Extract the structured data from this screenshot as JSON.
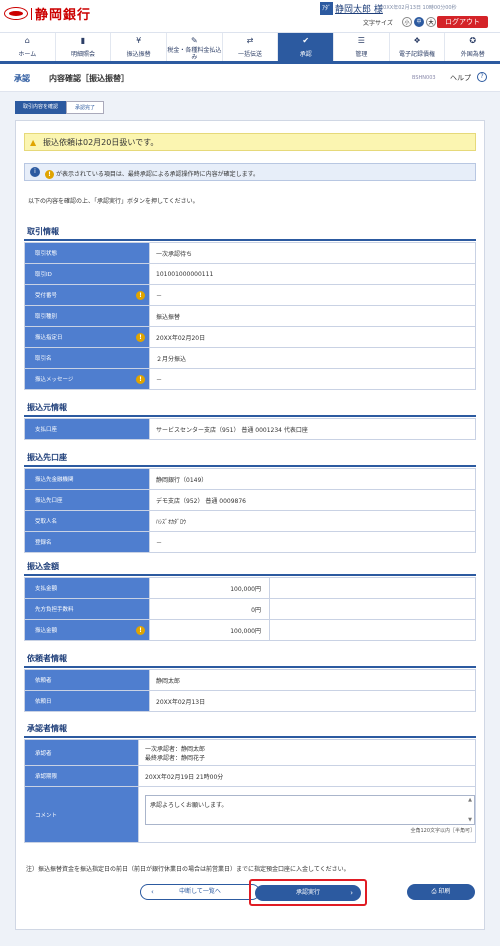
{
  "header": {
    "logo_text": "静岡銀行",
    "user_icon": "ｱﾀﾞ",
    "user_name": "静岡太郎 様",
    "datetime": "20XX年02月13日 10時00分00秒",
    "font_size_label": "文字サイズ",
    "font_sizes": [
      "小",
      "中",
      "大"
    ],
    "logout": "ログアウト"
  },
  "nav": [
    {
      "label": "ホーム",
      "icon": "home-icon",
      "glyph": "⌂"
    },
    {
      "label": "明細照会",
      "icon": "document-icon",
      "glyph": "▮"
    },
    {
      "label": "振込振替",
      "icon": "transfer-icon",
      "glyph": "¥"
    },
    {
      "label": "税金・各種料金払込み",
      "icon": "tax-icon",
      "glyph": "✎"
    },
    {
      "label": "一括伝送",
      "icon": "batch-icon",
      "glyph": "⇄"
    },
    {
      "label": "承認",
      "icon": "approve-icon",
      "glyph": "✔"
    },
    {
      "label": "管理",
      "icon": "admin-icon",
      "glyph": "☰"
    },
    {
      "label": "電子記録債権",
      "icon": "ecredit-icon",
      "glyph": "❖"
    },
    {
      "label": "外国為替",
      "icon": "forex-icon",
      "glyph": "✪"
    }
  ],
  "title": {
    "main": "承認",
    "sub": "内容確認［振込振替］",
    "code": "BSHN003",
    "help": "ヘルプ"
  },
  "steps": [
    "取引内容を確認",
    "承認完了"
  ],
  "notice": "振込依頼は02月20日扱いです。",
  "info": "が表示されている項目は、最終承認による承認操作時に内容が確定します。",
  "instruction": "以下の内容を確認の上、「承認実行」ボタンを押してください。",
  "sections": {
    "torihiki": {
      "title": "取引情報",
      "rows": [
        {
          "label": "取引状態",
          "value": "一次承認待ち",
          "warn": false
        },
        {
          "label": "取引ID",
          "value": "101001000000111",
          "warn": false
        },
        {
          "label": "受付番号",
          "value": "－",
          "warn": true
        },
        {
          "label": "取引種別",
          "value": "振込振替",
          "warn": false
        },
        {
          "label": "振込指定日",
          "value": "20XX年02月20日",
          "warn": true
        },
        {
          "label": "取引名",
          "value": "２月分振込",
          "warn": false
        },
        {
          "label": "振込メッセージ",
          "value": "－",
          "warn": true
        }
      ]
    },
    "moto": {
      "title": "振込元情報",
      "rows": [
        {
          "label": "支払口座",
          "value": "サービスセンター支店（951） 普通 0001234 代表口座",
          "warn": false
        }
      ]
    },
    "saki": {
      "title": "振込先口座",
      "rows": [
        {
          "label": "振込先金融機関",
          "value": "静岡銀行（0149）",
          "warn": false
        },
        {
          "label": "振込先口座",
          "value": "デモ支店（952） 普通 0009876",
          "warn": false
        },
        {
          "label": "受取人名",
          "value": "ﾊｼｽﾞｵｶﾀﾞﾛｳ",
          "warn": false
        },
        {
          "label": "登録名",
          "value": "－",
          "warn": false
        }
      ]
    },
    "kingaku": {
      "title": "振込金額",
      "rows": [
        {
          "label": "支払金額",
          "value": "100,000円",
          "warn": false
        },
        {
          "label": "先方負担手数料",
          "value": "0円",
          "warn": false
        },
        {
          "label": "振込金額",
          "value": "100,000円",
          "warn": true
        }
      ]
    },
    "irai": {
      "title": "依頼者情報",
      "rows": [
        {
          "label": "依頼者",
          "value": "静岡太郎",
          "warn": false
        },
        {
          "label": "依頼日",
          "value": "20XX年02月13日",
          "warn": false
        }
      ]
    },
    "shonin": {
      "title": "承認者情報",
      "approver_label": "承認者",
      "approver_line1": "一次承認者：静岡太郎",
      "approver_line2": "最終承認者：静岡花子",
      "deadline_label": "承認期限",
      "deadline": "20XX年02月19日 21時00分",
      "comment_label": "コメント",
      "comment": "承認よろしくお願いします。",
      "comment_limit": "全角120文字以内［半角可］"
    }
  },
  "footnote": "注）振込振替資金を振込指定日の前日（前日が銀行休業日の場合は前営業日）までに指定預金口座に入金してください。",
  "buttons": {
    "back": "中断して一覧へ",
    "execute": "承認実行",
    "print": "印刷"
  },
  "colors": {
    "primary": "#2c5aa0",
    "label_bg": "#4f7ecf",
    "accent": "#d42328",
    "notice_bg": "#fbf5b1"
  }
}
